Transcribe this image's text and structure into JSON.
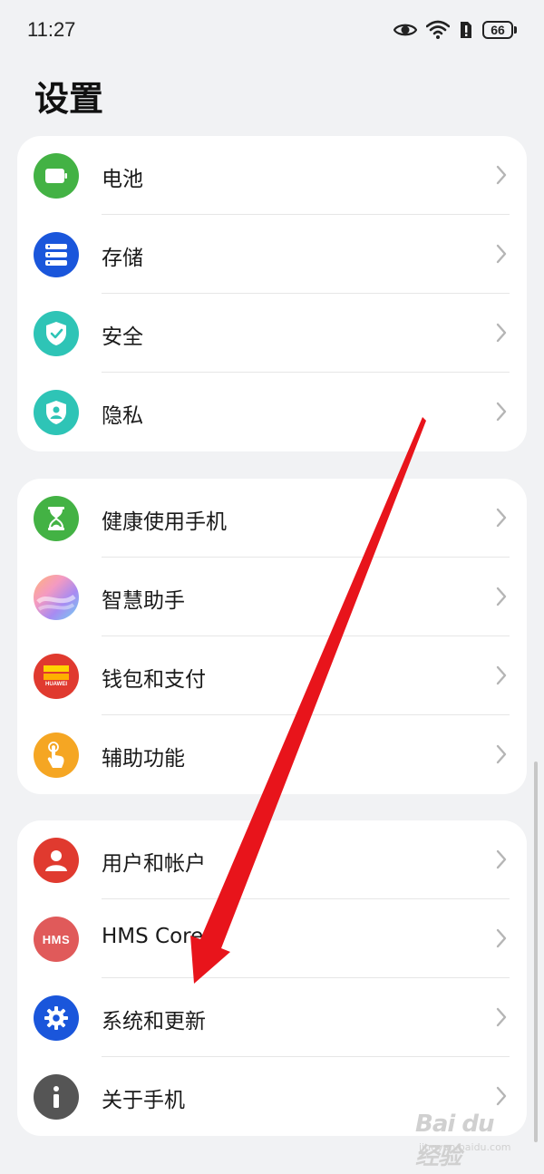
{
  "status_bar": {
    "time": "11:27",
    "battery_level": "66"
  },
  "page_title": "设置",
  "groups": [
    {
      "items": [
        {
          "label": "电池",
          "icon": "battery-icon",
          "color": "#43b244"
        },
        {
          "label": "存储",
          "icon": "storage-icon",
          "color": "#1a56db"
        },
        {
          "label": "安全",
          "icon": "shield-check-icon",
          "color": "#2ec4b6"
        },
        {
          "label": "隐私",
          "icon": "privacy-shield-icon",
          "color": "#2ec4b6"
        }
      ]
    },
    {
      "items": [
        {
          "label": "健康使用手机",
          "icon": "hourglass-icon",
          "color": "#43b244"
        },
        {
          "label": "智慧助手",
          "icon": "assistant-orb-icon",
          "color": "#8fb3f5"
        },
        {
          "label": "钱包和支付",
          "icon": "wallet-icon",
          "color": "#e03a2f",
          "badge": "HUAWEI"
        },
        {
          "label": "辅助功能",
          "icon": "hand-tap-icon",
          "color": "#f5a623"
        }
      ]
    },
    {
      "items": [
        {
          "label": "用户和帐户",
          "icon": "user-icon",
          "color": "#e03a2f"
        },
        {
          "label": "HMS Core",
          "icon": "hms-icon",
          "color": "#e05a5a",
          "badge": "HMS"
        },
        {
          "label": "系统和更新",
          "icon": "gear-icon",
          "color": "#1a56db"
        },
        {
          "label": "关于手机",
          "icon": "info-icon",
          "color": "#555555"
        }
      ]
    }
  ],
  "watermark": {
    "main": "Bai du经验",
    "sub": "jingyan.baidu.com"
  },
  "colors": {
    "background": "#f1f2f4",
    "annotation_arrow": "#e8141b"
  }
}
